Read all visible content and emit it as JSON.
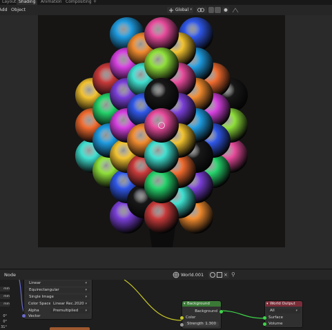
{
  "tabs": [
    "Layout",
    "Shading",
    "Animation",
    "Compositing",
    "+"
  ],
  "header": {
    "left_items": [
      "Add",
      "Object"
    ],
    "transform": "Global"
  },
  "viewport": {
    "sphere_colors": [
      "#e84b9c",
      "#f06a2e",
      "#25d36b",
      "#1e9be0",
      "#7a3fd8",
      "#f2c230",
      "#3fe0d0",
      "#c83a3a",
      "#8fe03a",
      "#d640e0",
      "#2f57e8",
      "#f08a2e",
      "#181818"
    ]
  },
  "node_header": {
    "title": "Node",
    "world_name": "World.001"
  },
  "image_node": {
    "interpolation": "Linear",
    "projection": "Equirectangular",
    "extension": "Single Image",
    "color_space_label": "Color Space",
    "color_space": "Linear Rec.2020",
    "alpha_label": "Alpha",
    "alpha": "Premultiplied",
    "vector_label": "Vector"
  },
  "side_panel": {
    "units": [
      "mm",
      "mm",
      "mm"
    ],
    "rotations": [
      "0°",
      "0°",
      "31°"
    ]
  },
  "background_node": {
    "title": "Background",
    "output": "Background",
    "color_label": "Color",
    "strength_label": "Strength",
    "strength": "1.300"
  },
  "output_node": {
    "title": "World Output",
    "target": "All",
    "surface": "Surface",
    "volume": "Volume"
  },
  "colors": {
    "bg_node_header": "#3a7a36",
    "output_node_header": "#7a2d38",
    "accent_tab": "#2e2e2e",
    "socket_yellow": "#c7c729",
    "socket_green": "#3fd44a",
    "socket_blue": "#6b6bd0",
    "socket_gray": "#9a9a9a"
  }
}
